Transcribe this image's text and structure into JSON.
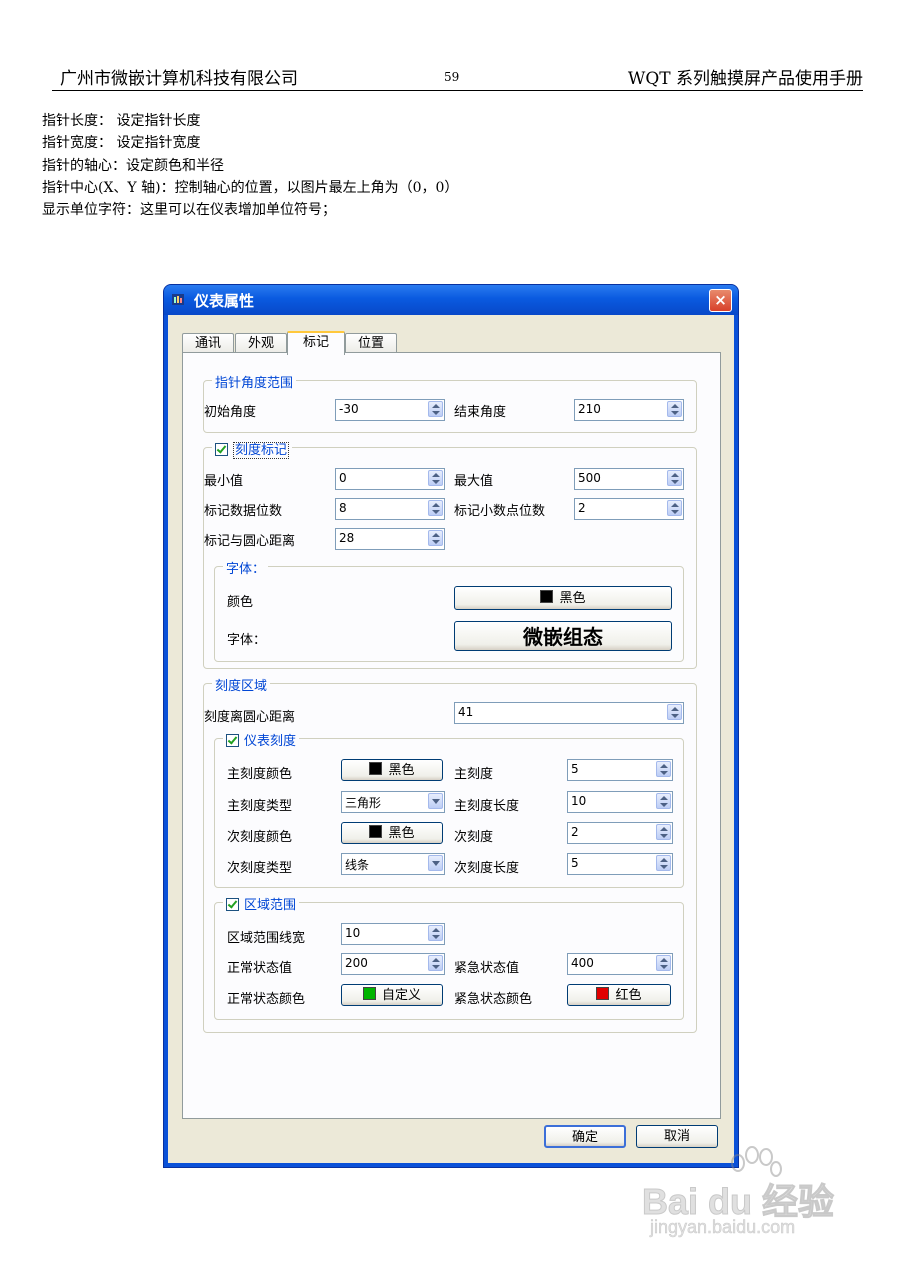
{
  "page_header": {
    "company": "广州市微嵌计算机科技有限公司",
    "page_number": "59",
    "manual_title": "WQT 系列触摸屏产品使用手册"
  },
  "intro_lines": [
    "指针长度：   设定指针长度",
    "指针宽度：   设定指针宽度",
    "指针的轴心：设定颜色和半径",
    "指针中心(X、Y 轴)：控制轴心的位置，以图片最左上角为（0，0）",
    "显示单位字符：这里可以在仪表增加单位符号；"
  ],
  "dialog": {
    "title": "仪表属性",
    "close_label": "×",
    "tabs": [
      "通讯",
      "外观",
      "标记",
      "位置"
    ],
    "pointer_range": {
      "legend": "指针角度范围",
      "start_label": "初始角度",
      "start_value": "-30",
      "end_label": "结束角度",
      "end_value": "210"
    },
    "scale_mark": {
      "legend": "刻度标记",
      "min_label": "最小值",
      "min_value": "0",
      "max_label": "最大值",
      "max_value": "500",
      "digits_label": "标记数据位数",
      "digits_value": "8",
      "decimals_label": "标记小数点位数",
      "decimals_value": "2",
      "distance_label": "标记与圆心距离",
      "distance_value": "28",
      "font_group": {
        "legend": "字体：",
        "color_label": "颜色",
        "color_button": "黑色",
        "font_label": "字体：",
        "font_button": "微嵌组态"
      }
    },
    "scale_area": {
      "legend": "刻度区域",
      "distance_label": "刻度离圆心距离",
      "distance_value": "41",
      "meter_scale": {
        "legend": "仪表刻度",
        "major_color_label": "主刻度颜色",
        "major_color_button": "黑色",
        "major_label": "主刻度",
        "major_value": "5",
        "major_type_label": "主刻度类型",
        "major_type_value": "三角形",
        "major_length_label": "主刻度长度",
        "major_length_value": "10",
        "minor_color_label": "次刻度颜色",
        "minor_color_button": "黑色",
        "minor_label": "次刻度",
        "minor_value": "2",
        "minor_type_label": "次刻度类型",
        "minor_type_value": "线条",
        "minor_length_label": "次刻度长度",
        "minor_length_value": "5"
      },
      "zone_range": {
        "legend": "区域范围",
        "line_width_label": "区域范围线宽",
        "line_width_value": "10",
        "normal_label": "正常状态值",
        "normal_value": "200",
        "alarm_label": "紧急状态值",
        "alarm_value": "400",
        "normal_color_label": "正常状态颜色",
        "normal_color_button": "自定义",
        "alarm_color_label": "紧急状态颜色",
        "alarm_color_button": "红色"
      }
    }
  },
  "buttons": {
    "ok": "确定",
    "cancel": "取消"
  },
  "colors": {
    "title_blue": "#0a5ae0",
    "legend_blue": "#0046d5",
    "black": "#000000",
    "green": "#00b400",
    "red": "#e00000"
  }
}
